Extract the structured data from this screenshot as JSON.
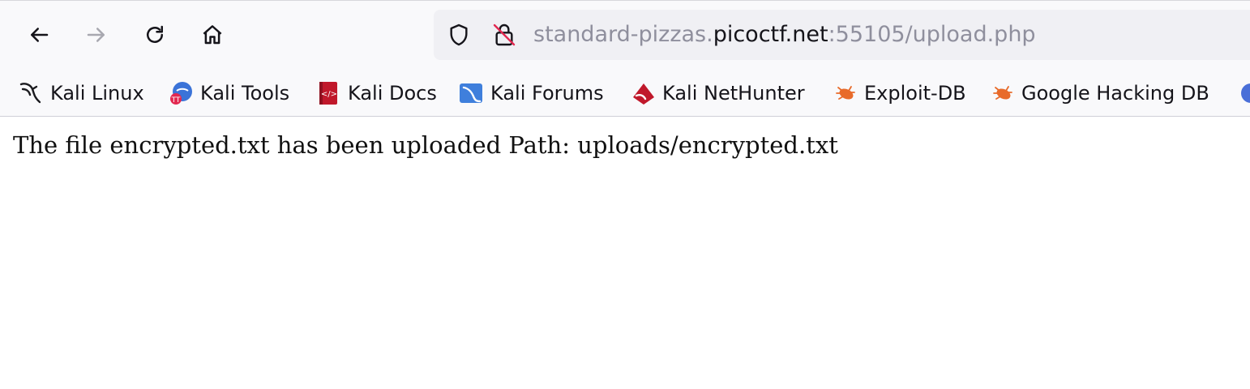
{
  "browser": {
    "url": {
      "prefix": "standard-pizzas.",
      "domain": "picoctf.net",
      "suffix": ":55105/upload.php"
    }
  },
  "bookmarks": [
    {
      "label": "Kali Linux",
      "icon": "kali-dragon-icon"
    },
    {
      "label": "Kali Tools",
      "icon": "kali-tools-icon"
    },
    {
      "label": "Kali Docs",
      "icon": "kali-docs-icon"
    },
    {
      "label": "Kali Forums",
      "icon": "kali-forums-icon"
    },
    {
      "label": "Kali NetHunter",
      "icon": "kali-nethunter-icon"
    },
    {
      "label": "Exploit-DB",
      "icon": "exploit-db-icon"
    },
    {
      "label": "Google Hacking DB",
      "icon": "ghdb-icon"
    }
  ],
  "page": {
    "message": "The file encrypted.txt has been uploaded Path: uploads/encrypted.txt"
  }
}
